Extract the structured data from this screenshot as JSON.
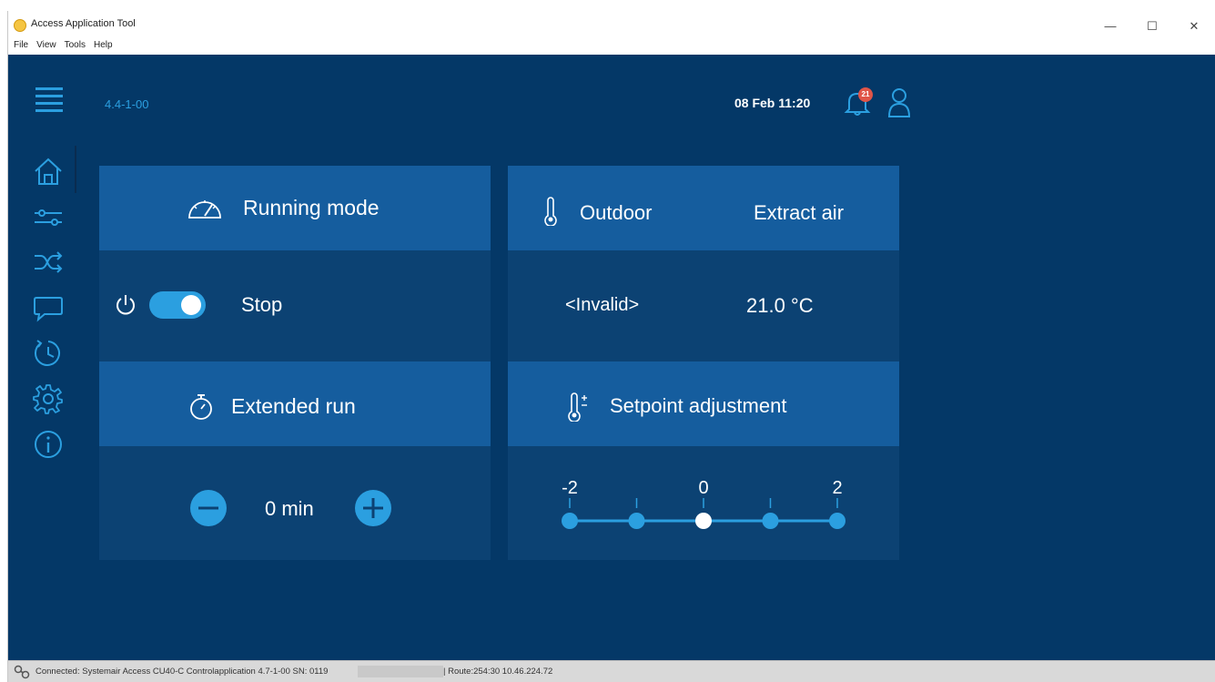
{
  "window": {
    "title": "Access Application Tool",
    "menu": [
      "File",
      "View",
      "Tools",
      "Help"
    ],
    "controls": {
      "minimize": "—",
      "maximize": "☐",
      "close": "✕"
    }
  },
  "header": {
    "version": "4.4-1-00",
    "datetime": "08 Feb 11:20",
    "notification_count": "21"
  },
  "sidebar": {
    "items": [
      "home-icon",
      "sliders-icon",
      "shuffle-icon",
      "chat-icon",
      "history-icon",
      "gear-icon",
      "info-icon"
    ]
  },
  "running_mode": {
    "title": "Running mode",
    "state_label": "Stop",
    "toggle_on": true
  },
  "extended_run": {
    "title": "Extended run",
    "value": "0 min"
  },
  "temperatures": {
    "outdoor_label": "Outdoor",
    "extract_label": "Extract air",
    "outdoor_value": "<Invalid>",
    "extract_value": "21.0 °C"
  },
  "setpoint": {
    "title": "Setpoint adjustment",
    "tick_labels": [
      "-2",
      "0",
      "2"
    ],
    "steps": [
      -2,
      -1,
      0,
      1,
      2
    ],
    "current": 0
  },
  "colors": {
    "background": "#043867",
    "card": "#0c4273",
    "card_header": "#155d9e",
    "accent": "#2b9fe0",
    "badge": "#e05548"
  },
  "status": {
    "connection": "Connected: Systemair Access CU40-C Controlapplication 4.7-1-00 SN: 0119",
    "route": "| Route:254:30 10.46.224.72"
  }
}
